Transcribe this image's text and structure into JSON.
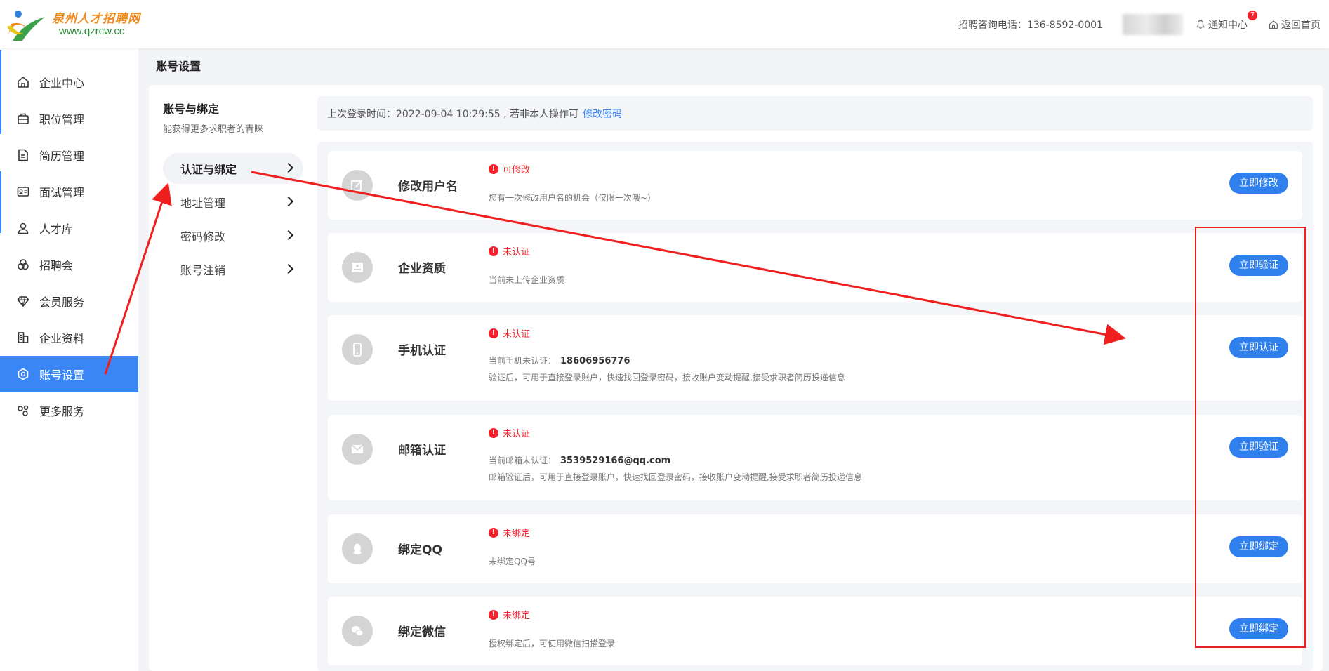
{
  "header": {
    "logo_name": "泉州人才招聘网",
    "logo_url": "www.qzrcw.cc",
    "hotline": "招聘咨询电话：136-8592-0001",
    "notify_label": "通知中心",
    "notify_count": "7",
    "home_label": "返回首页"
  },
  "sidebar": {
    "items": [
      {
        "label": "企业中心",
        "icon": "home-icon"
      },
      {
        "label": "职位管理",
        "icon": "briefcase-icon"
      },
      {
        "label": "简历管理",
        "icon": "document-icon"
      },
      {
        "label": "面试管理",
        "icon": "id-card-icon"
      },
      {
        "label": "人才库",
        "icon": "user-icon"
      },
      {
        "label": "招聘会",
        "icon": "venn-icon"
      },
      {
        "label": "会员服务",
        "icon": "diamond-icon"
      },
      {
        "label": "企业资料",
        "icon": "building-icon"
      },
      {
        "label": "账号设置",
        "icon": "settings-icon",
        "active": true
      },
      {
        "label": "更多服务",
        "icon": "share-icon"
      }
    ]
  },
  "page": {
    "title": "账号设置"
  },
  "subnav": {
    "title": "账号与绑定",
    "desc": "能获得更多求职者的青睐",
    "items": [
      {
        "label": "认证与绑定",
        "active": true
      },
      {
        "label": "地址管理"
      },
      {
        "label": "密码修改"
      },
      {
        "label": "账号注销"
      }
    ]
  },
  "login_bar": {
    "text": "上次登录时间：2022-09-04 10:29:55 , 若非本人操作可",
    "link": "修改密码"
  },
  "cards": [
    {
      "title": "修改用户名",
      "icon": "edit-icon",
      "status": "可修改",
      "line1": "您有一次修改用户名的机会（仅限一次哦~）",
      "button": "立即修改"
    },
    {
      "title": "企业资质",
      "icon": "license-icon",
      "status": "未认证",
      "line1": "当前未上传企业资质",
      "button": "立即验证"
    },
    {
      "title": "手机认证",
      "icon": "phone-icon",
      "status": "未认证",
      "line1": "当前手机未认证：",
      "line1_value": "18606956776",
      "line2": "验证后，可用于直接登录账户，快速找回登录密码，接收账户变动提醒,接受求职者简历投递信息",
      "button": "立即认证"
    },
    {
      "title": "邮箱认证",
      "icon": "mail-icon",
      "status": "未认证",
      "line1": "当前邮箱未认证：",
      "line1_value": "3539529166@qq.com",
      "line2": "邮箱验证后，可用于直接登录账户，快速找回登录密码，接收账户变动提醒,接受求职者简历投递信息",
      "button": "立即验证"
    },
    {
      "title": "绑定QQ",
      "icon": "qq-icon",
      "status": "未绑定",
      "line1": "未绑定QQ号",
      "button": "立即绑定"
    },
    {
      "title": "绑定微信",
      "icon": "wechat-icon",
      "status": "未绑定",
      "line1": "授权绑定后，可使用微信扫描登录",
      "button": "立即绑定"
    }
  ],
  "colors": {
    "primary": "#3a86f6",
    "button": "#2f80ed",
    "warning": "#f5222d",
    "annotation": "#f01f1f"
  }
}
